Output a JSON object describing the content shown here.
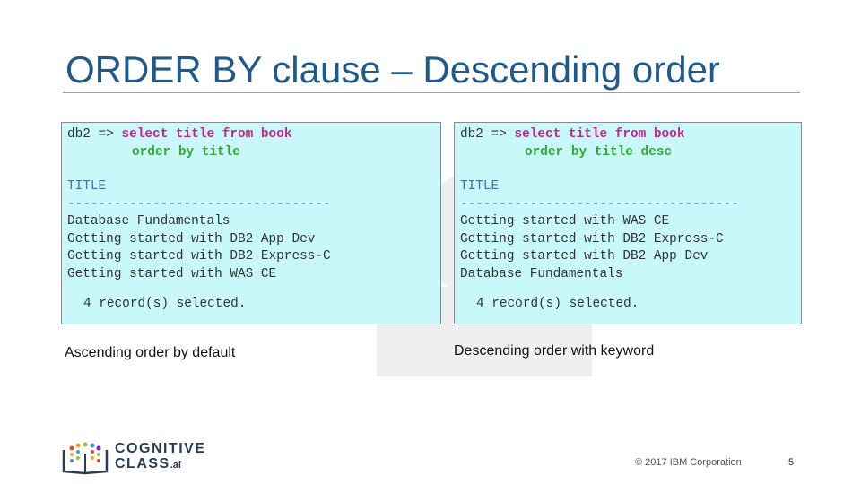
{
  "slide": {
    "title": "ORDER BY clause – Descending order",
    "page_number": "5",
    "copyright": "© 2017 IBM Corporation"
  },
  "logo": {
    "line1": "COGNITIVE",
    "line2": "CLASS",
    "suffix": ".ai"
  },
  "left_panel": {
    "prompt": "db2 =>",
    "query_keywords": "select title from book",
    "query_clause": "order by title",
    "column_header": "TITLE",
    "separator": "----------------------------------",
    "rows": [
      "Database Fundamentals",
      "Getting started with DB2 App Dev",
      "Getting started with DB2 Express-C",
      "Getting started with WAS CE"
    ],
    "summary": "4 record(s) selected.",
    "caption": "Ascending order by default"
  },
  "right_panel": {
    "prompt": "db2 =>",
    "query_keywords": "select title from book",
    "query_clause": "order by title desc",
    "column_header": "TITLE",
    "separator": "------------------------------------",
    "rows": [
      "Getting started with WAS CE",
      "Getting started with DB2 Express-C",
      "Getting started with DB2 App Dev",
      "Database Fundamentals"
    ],
    "summary": "4 record(s) selected.",
    "caption": "Descending order with keyword"
  }
}
